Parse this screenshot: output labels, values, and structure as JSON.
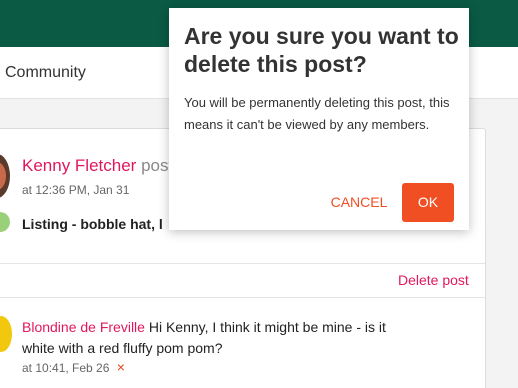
{
  "page": {
    "section_title": "Community"
  },
  "post": {
    "author": "Kenny Fletcher",
    "action_fragment": "poste",
    "timestamp": "at  12:36 PM, Jan 31",
    "listing_text": "Listing  -  bobble hat, l",
    "delete_label": "Delete post"
  },
  "reply": {
    "author": "Blondine de Freville",
    "text": " Hi Kenny, I think it might be mine - is it white with a red fluffy pom pom?",
    "timestamp": "at 10:41, Feb 26",
    "remove_icon": "×"
  },
  "dialog": {
    "title": "Are you sure you want to delete this post?",
    "body": "You will be permanently deleting this post, this means it can't be viewed by any members.",
    "cancel_label": "CANCEL",
    "ok_label": "OK"
  },
  "colors": {
    "header_green": "#0a5a44",
    "accent_pink": "#e1185f",
    "button_orange": "#f04e23"
  }
}
